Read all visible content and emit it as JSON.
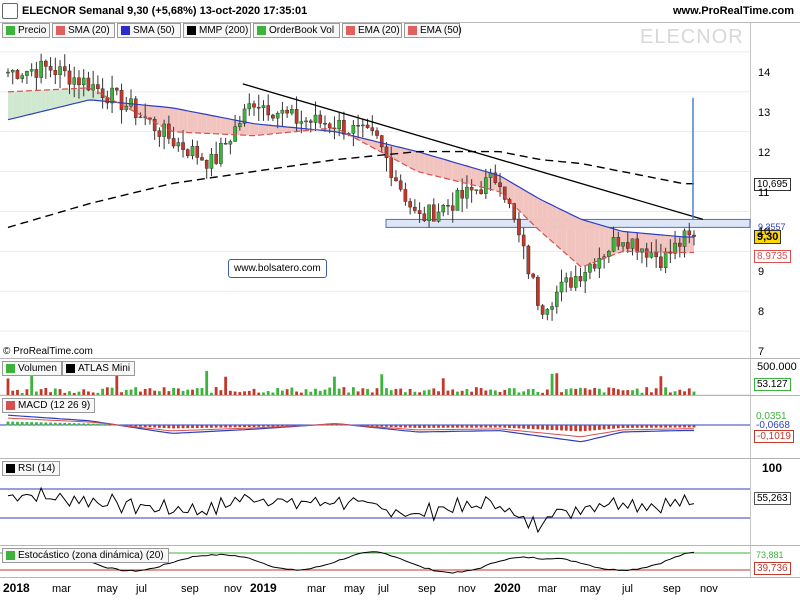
{
  "header": {
    "title": "ELECNOR Semanal 9,30 (+5,68%) 13-oct-2020 17:35:01",
    "site": "www.ProRealTime.com"
  },
  "legend": [
    {
      "label": "Precio",
      "color": "#3cb43c"
    },
    {
      "label": "SMA (20)",
      "color": "#e06060"
    },
    {
      "label": "SMA (50)",
      "color": "#2c2ccc"
    },
    {
      "label": "MMP (200)",
      "color": "#000000"
    },
    {
      "label": "OrderBook Vol",
      "color": "#3cb43c"
    },
    {
      "label": "EMA (20)",
      "color": "#e06060"
    },
    {
      "label": "EMA (50)",
      "color": "#e06060"
    }
  ],
  "watermark": "ELECNOR",
  "annotation_box": "www.bolsatero.com",
  "copyright": "© ProRealTime.com",
  "colors": {
    "up": "#3cb43c",
    "down": "#c0392b",
    "sma20": "#d94f4f",
    "sma50": "#2c3fbf",
    "mmp200": "#000000",
    "fill_green": "#cfe8cf",
    "fill_red": "#f2c4c0",
    "zone": "#dce6f7"
  },
  "price_axis": {
    "ticks": [
      "14",
      "13",
      "12",
      "11",
      "10",
      "9",
      "8",
      "7"
    ],
    "tags": {
      "last": "9,30",
      "mmp200": "10,695",
      "sma20": "8,9735",
      "blue": "9,3557"
    }
  },
  "time_axis": [
    "2018",
    "mar",
    "may",
    "jul",
    "sep",
    "nov",
    "2019",
    "mar",
    "may",
    "jul",
    "sep",
    "nov",
    "2020",
    "mar",
    "may",
    "jul",
    "sep",
    "nov"
  ],
  "panels": {
    "volume": {
      "label": "Volumen",
      "label2": "ATLAS Mini",
      "ticks": [
        "500.000"
      ],
      "value": "53.127"
    },
    "macd": {
      "label": "MACD (12 26 9)",
      "values": [
        "0,0351",
        "-0,0668",
        "-0,1019"
      ]
    },
    "rsi": {
      "label": "RSI (14)",
      "ticks": [
        "100"
      ],
      "value": "55,263"
    },
    "stoch": {
      "label": "Estocástico (zona dinámica) (20)",
      "values": [
        "73,881",
        "39,736"
      ]
    }
  },
  "chart_data": {
    "type": "candlestick",
    "title": "ELECNOR Semanal",
    "timeframe": "weekly",
    "ylim": [
      6.4,
      14.6
    ],
    "y_scale": "linear",
    "last_close": 9.3,
    "change_pct": 5.68,
    "date": "13-oct-2020",
    "series": [
      {
        "name": "Precio",
        "x": [
          "2018-01",
          "2018-03",
          "2018-05",
          "2018-07",
          "2018-09",
          "2018-11",
          "2019-01",
          "2019-03",
          "2019-05",
          "2019-07",
          "2019-09",
          "2019-11",
          "2020-01",
          "2020-03",
          "2020-05",
          "2020-07",
          "2020-09",
          "2020-10"
        ],
        "values": [
          13.5,
          13.6,
          13.2,
          12.6,
          11.8,
          11.2,
          12.8,
          12.3,
          12.2,
          11.8,
          9.8,
          10.3,
          10.9,
          7.6,
          8.5,
          9.4,
          8.8,
          9.3
        ]
      },
      {
        "name": "SMA (20)",
        "x": [
          "2018-01",
          "2018-05",
          "2018-09",
          "2019-01",
          "2019-05",
          "2019-09",
          "2020-01",
          "2020-03",
          "2020-05",
          "2020-07",
          "2020-10"
        ],
        "values": [
          13.0,
          13.1,
          12.0,
          11.9,
          12.1,
          11.0,
          10.5,
          9.5,
          8.6,
          9.0,
          8.97
        ]
      },
      {
        "name": "SMA (50)",
        "x": [
          "2018-01",
          "2018-05",
          "2018-09",
          "2019-01",
          "2019-05",
          "2019-09",
          "2020-01",
          "2020-03",
          "2020-05",
          "2020-07",
          "2020-10"
        ],
        "values": [
          12.3,
          12.8,
          12.6,
          12.2,
          12.0,
          11.5,
          10.9,
          10.3,
          9.8,
          9.5,
          9.36
        ]
      },
      {
        "name": "MMP (200)",
        "x": [
          "2018-01",
          "2018-05",
          "2018-09",
          "2019-01",
          "2019-05",
          "2019-09",
          "2020-01",
          "2020-03",
          "2020-05",
          "2020-07",
          "2020-10"
        ],
        "values": [
          9.6,
          10.2,
          10.7,
          11.0,
          11.3,
          11.5,
          11.5,
          11.3,
          11.2,
          11.0,
          10.695
        ]
      }
    ],
    "trendline": {
      "x": [
        "2018-11",
        "2020-10"
      ],
      "values": [
        13.2,
        9.8
      ]
    },
    "support_zone": [
      9.6,
      9.8
    ]
  }
}
